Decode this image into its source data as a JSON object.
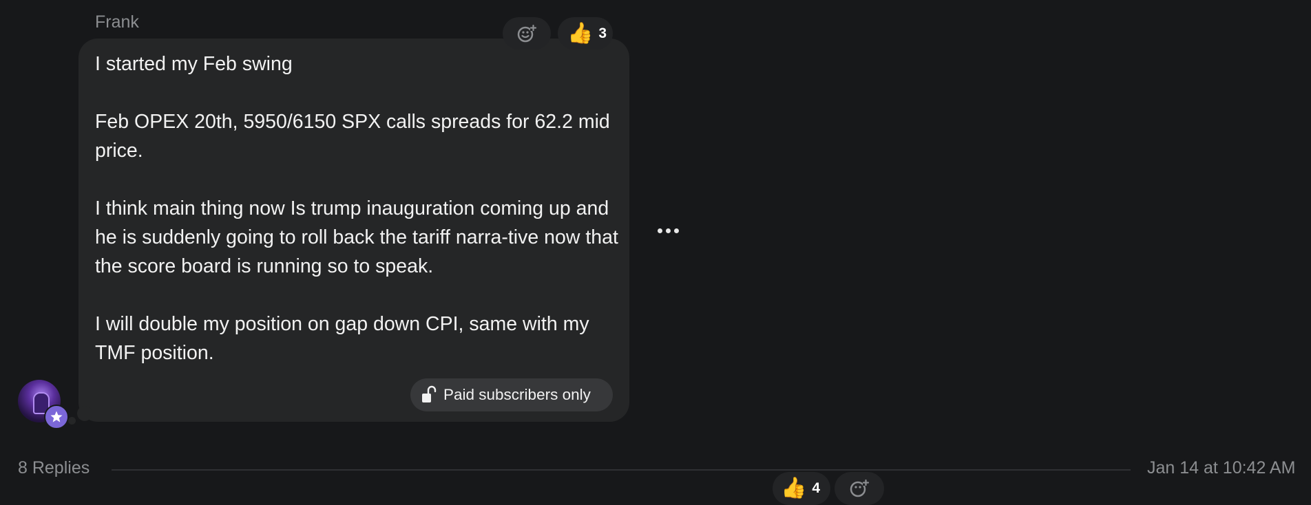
{
  "message": {
    "author": "Frank",
    "paragraphs": [
      "I started my Feb swing",
      "Feb OPEX 20th, 5950/6150 SPX calls spreads for 62.2 mid price.",
      "I think main thing now Is trump inauguration coming up and he is suddenly going to roll back the tariff narra-tive now that the score board is running so to speak.",
      "I will double my position on gap down CPI, same with my TMF position."
    ],
    "reactions": {
      "thumbs_up_emoji": "👍",
      "thumbs_up_count": "3",
      "add_reaction_icon": "emoji-plus-icon"
    },
    "paid_label": "Paid subscribers only",
    "more_icon": "ellipsis-icon"
  },
  "thread": {
    "replies_label": "8 Replies",
    "timestamp": "Jan 14 at 10:42 AM"
  },
  "next_message": {
    "thumbs_up_emoji": "👍",
    "thumbs_up_count": "4"
  },
  "colors": {
    "background": "#17181a",
    "bubble": "#252627",
    "badge": "#7b67d8",
    "muted_text": "#8c8e91"
  }
}
